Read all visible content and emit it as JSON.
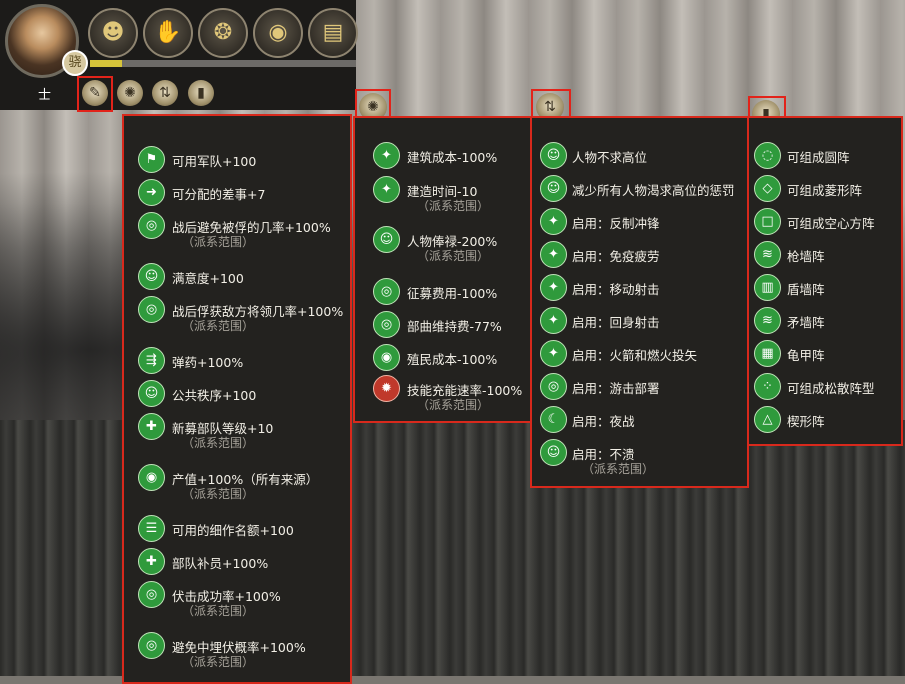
{
  "header": {
    "rank_label": "士",
    "rank_badge": "骁",
    "top_icons": [
      "people-icon",
      "handshake-icon",
      "swirl-icon",
      "eye-lock-icon",
      "scroll-icon"
    ],
    "progress": 0.12
  },
  "tabs": [
    {
      "name": "quill-tab-icon",
      "glyph": "✎"
    },
    {
      "name": "burst-tab-icon",
      "glyph": "✺"
    },
    {
      "name": "arrows-tab-icon",
      "glyph": "⇅"
    },
    {
      "name": "shield-tab-icon",
      "glyph": "▮"
    }
  ],
  "panels": {
    "military": {
      "rows": [
        {
          "text": "可用军队+100",
          "sub": ""
        },
        {
          "text": "可分配的差事+7",
          "sub": ""
        },
        {
          "text": "战后避免被俘的几率+100%",
          "sub": "（派系范围）"
        },
        {
          "text": "满意度+100",
          "sub": ""
        },
        {
          "text": "战后俘获敌方将领几率+100%",
          "sub": "（派系范围）"
        },
        {
          "text": "弹药+100%",
          "sub": ""
        },
        {
          "text": "公共秩序+100",
          "sub": ""
        },
        {
          "text": "新募部队等级+10",
          "sub": "（派系范围）"
        },
        {
          "text": "产值+100%（所有来源）",
          "sub": "（派系范围）"
        },
        {
          "text": "可用的细作名额+100",
          "sub": ""
        },
        {
          "text": "部队补员+100%",
          "sub": ""
        },
        {
          "text": "伏击成功率+100%",
          "sub": "（派系范围）"
        },
        {
          "text": "避免中埋伏概率+100%",
          "sub": "（派系范围）"
        }
      ]
    },
    "economy": {
      "rows": [
        {
          "text": "建筑成本-100%",
          "sub": ""
        },
        {
          "text": "建造时间-10",
          "sub": "（派系范围）"
        },
        {
          "text": "人物俸禄-200%",
          "sub": "（派系范围）"
        },
        {
          "text": "征募费用-100%",
          "sub": ""
        },
        {
          "text": "部曲维持费-77%",
          "sub": ""
        },
        {
          "text": "殖民成本-100%",
          "sub": ""
        },
        {
          "text": "技能充能速率-100%",
          "sub": "（派系范围）"
        }
      ]
    },
    "abilities": {
      "rows": [
        {
          "text": "人物不求高位",
          "sub": ""
        },
        {
          "text": "减少所有人物渴求高位的惩罚",
          "sub": ""
        },
        {
          "text": "启用：反制冲锋",
          "sub": ""
        },
        {
          "text": "启用：免疫疲劳",
          "sub": ""
        },
        {
          "text": "启用：移动射击",
          "sub": ""
        },
        {
          "text": "启用：回身射击",
          "sub": ""
        },
        {
          "text": "启用：火箭和燃火投矢",
          "sub": ""
        },
        {
          "text": "启用：游击部署",
          "sub": ""
        },
        {
          "text": "启用：夜战",
          "sub": ""
        },
        {
          "text": "启用：不溃",
          "sub": "（派系范围）"
        }
      ]
    },
    "formations": {
      "rows": [
        {
          "text": "可组成圆阵",
          "sub": ""
        },
        {
          "text": "可组成菱形阵",
          "sub": ""
        },
        {
          "text": "可组成空心方阵",
          "sub": ""
        },
        {
          "text": "枪墙阵",
          "sub": ""
        },
        {
          "text": "盾墙阵",
          "sub": ""
        },
        {
          "text": "矛墙阵",
          "sub": ""
        },
        {
          "text": "龟甲阵",
          "sub": ""
        },
        {
          "text": "可组成松散阵型",
          "sub": ""
        },
        {
          "text": "楔形阵",
          "sub": ""
        }
      ]
    }
  }
}
